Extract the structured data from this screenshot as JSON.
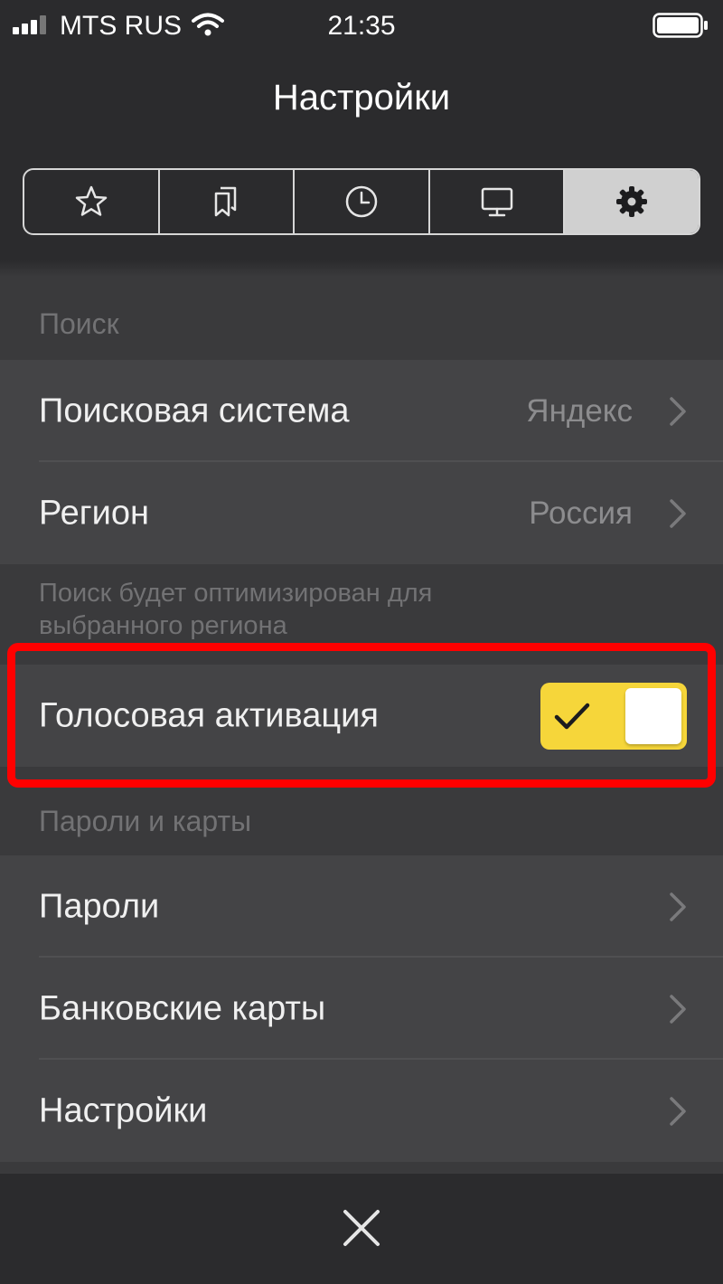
{
  "status_bar": {
    "carrier": "MTS RUS",
    "time": "21:35",
    "icons": [
      "signal-icon",
      "wifi-icon",
      "battery-icon"
    ]
  },
  "header": {
    "title": "Настройки",
    "tabs": [
      {
        "icon": "star-icon",
        "active": false
      },
      {
        "icon": "bookmarks-icon",
        "active": false
      },
      {
        "icon": "history-clock-icon",
        "active": false
      },
      {
        "icon": "monitor-icon",
        "active": false
      },
      {
        "icon": "gear-icon",
        "active": true
      }
    ]
  },
  "search_section": {
    "header": "Поиск",
    "rows": [
      {
        "label": "Поисковая система",
        "value": "Яндекс"
      },
      {
        "label": "Регион",
        "value": "Россия"
      }
    ],
    "footnote": "Поиск будет оптимизирован для выбранного региона"
  },
  "voice_activation": {
    "label": "Голосовая активация",
    "enabled": true
  },
  "passwords_section": {
    "header": "Пароли и карты",
    "rows": [
      {
        "label": "Пароли"
      },
      {
        "label": "Банковские карты"
      },
      {
        "label": "Настройки"
      }
    ]
  },
  "bottom_bar": {
    "icon": "close-icon"
  },
  "colors": {
    "background": "#3a3a3c",
    "header_background": "#2b2b2d",
    "toggle_on": "#f6d63a",
    "highlight": "#ff0000",
    "muted_text": "#727274"
  }
}
